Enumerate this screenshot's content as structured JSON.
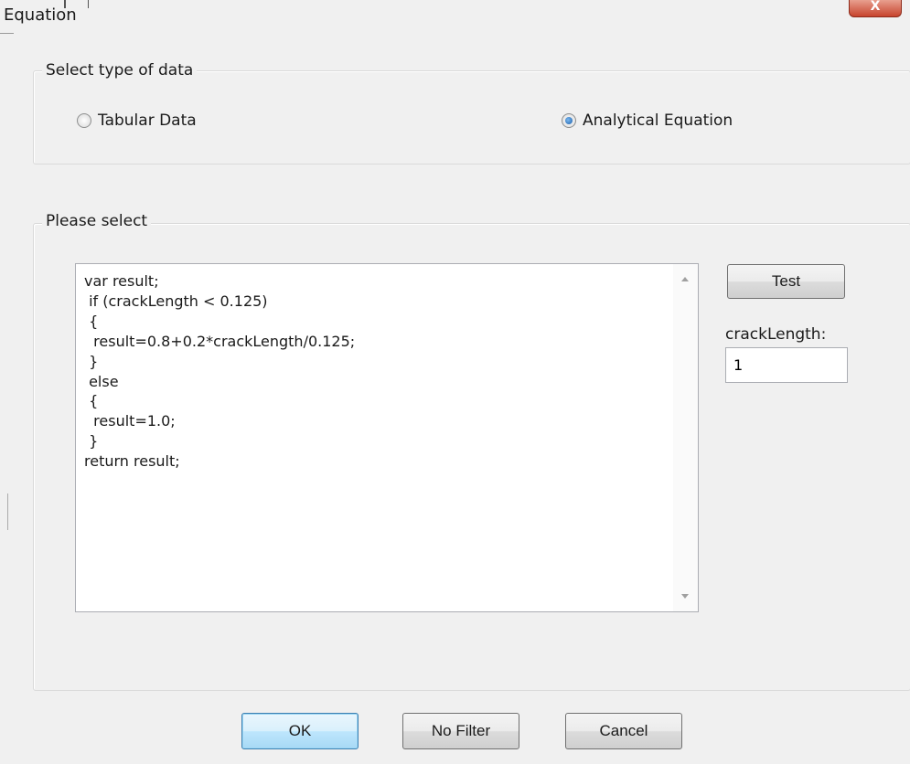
{
  "window": {
    "title": "Equation",
    "close_label": "X"
  },
  "data_type_group": {
    "legend": "Select type of data",
    "options": [
      {
        "label": "Tabular Data",
        "selected": false
      },
      {
        "label": "Analytical Equation",
        "selected": true
      }
    ]
  },
  "select_group": {
    "legend": "Please select"
  },
  "equation": {
    "code": "var result;\n if (crackLength < 0.125)\n {\n  result=0.8+0.2*crackLength/0.125;\n }\n else\n {\n  result=1.0;\n }\nreturn result;"
  },
  "test_panel": {
    "test_label": "Test",
    "param_label": "crackLength:",
    "param_value": "1"
  },
  "footer": {
    "ok_label": "OK",
    "no_filter_label": "No Filter",
    "cancel_label": "Cancel"
  }
}
